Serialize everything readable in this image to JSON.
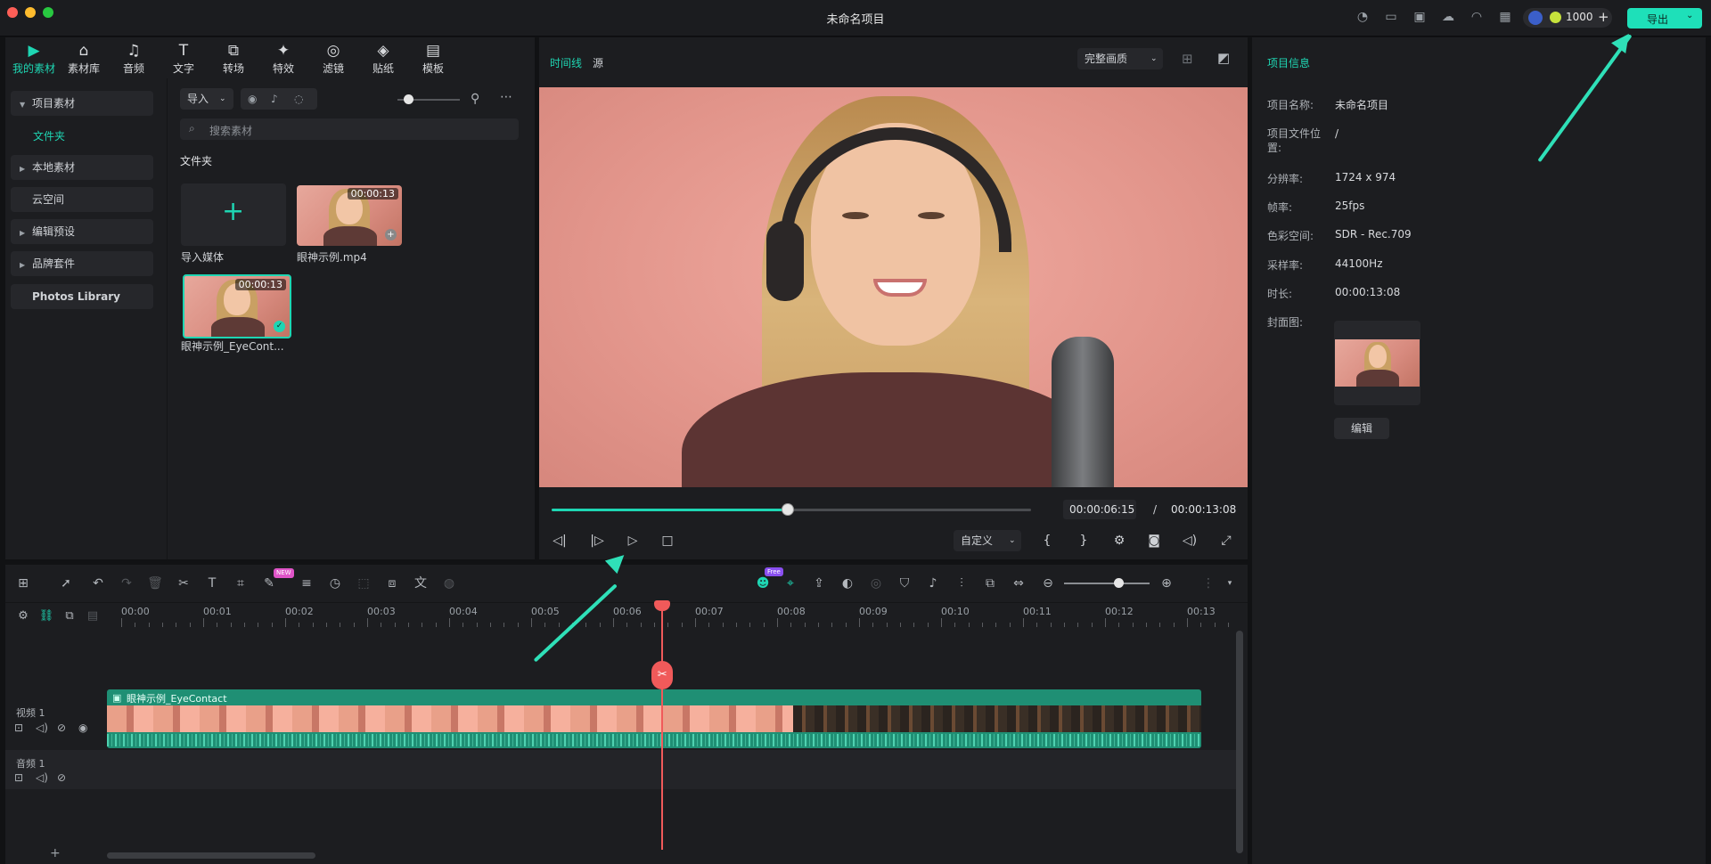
{
  "window": {
    "title": "未命名项目"
  },
  "topbar": {
    "credits": "1000",
    "export_label": "导出"
  },
  "media_tabs": [
    {
      "label": "我的素材",
      "icon": "my-media-icon"
    },
    {
      "label": "素材库",
      "icon": "store-icon"
    },
    {
      "label": "音频",
      "icon": "music-icon"
    },
    {
      "label": "文字",
      "icon": "text-icon"
    },
    {
      "label": "转场",
      "icon": "transition-icon"
    },
    {
      "label": "特效",
      "icon": "effects-icon"
    },
    {
      "label": "滤镜",
      "icon": "filter-icon"
    },
    {
      "label": "贴纸",
      "icon": "sticker-icon"
    },
    {
      "label": "模板",
      "icon": "template-icon"
    }
  ],
  "sidebar": {
    "project_media": "项目素材",
    "folder": "文件夹",
    "local_media": "本地素材",
    "cloud": "云空间",
    "edit_presets": "编辑预设",
    "brand_kit": "品牌套件",
    "photos_library": "Photos Library"
  },
  "media": {
    "import_label": "导入",
    "search_placeholder": "搜索素材",
    "section_title": "文件夹",
    "import_media_label": "导入媒体",
    "items": [
      {
        "name": "眼神示例.mp4",
        "duration": "00:00:13"
      },
      {
        "name": "眼神示例_EyeCont...",
        "duration": "00:00:13"
      }
    ]
  },
  "preview": {
    "tab_timeline": "时间线",
    "tab_source": "源",
    "quality": "完整画质",
    "current_time": "00:00:06:15",
    "separator": "/",
    "total_time": "00:00:13:08",
    "progress": 0.49,
    "custom_label": "自定义"
  },
  "info": {
    "header": "项目信息",
    "name_label": "项目名称:",
    "name_value": "未命名项目",
    "path_label": "项目文件位置:",
    "path_value": "/",
    "resolution_label": "分辨率:",
    "resolution_value": "1724 x 974",
    "fps_label": "帧率:",
    "fps_value": "25fps",
    "color_label": "色彩空间:",
    "color_value": "SDR - Rec.709",
    "sample_label": "采样率:",
    "sample_value": "44100Hz",
    "duration_label": "时长:",
    "duration_value": "00:00:13:08",
    "cover_label": "封面图:",
    "edit_label": "编辑"
  },
  "timeline": {
    "ticks": [
      "00:00",
      "00:01",
      "00:02",
      "00:03",
      "00:04",
      "00:05",
      "00:06",
      "00:07",
      "00:08",
      "00:09",
      "00:10",
      "00:11",
      "00:12",
      "00:13"
    ],
    "video_track_label": "视频 1",
    "audio_track_label": "音频 1",
    "clip_name": "眼神示例_EyeContact",
    "playhead_time": 6.6,
    "badge_new": "NEW",
    "badge_free": "Free"
  },
  "colors": {
    "accent": "#1ed6b3",
    "playhead": "#f05a5a",
    "clip": "#1f8f74"
  }
}
